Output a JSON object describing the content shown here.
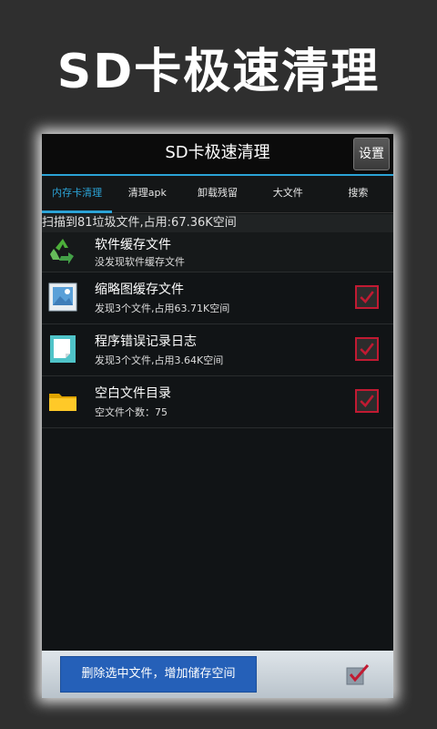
{
  "promo_title": "SD卡极速清理",
  "app": {
    "title": "SD卡极速清理",
    "settings_label": "设置"
  },
  "tabs": [
    {
      "label": "内存卡清理"
    },
    {
      "label": "清理apk"
    },
    {
      "label": "卸载残留"
    },
    {
      "label": "大文件"
    },
    {
      "label": "搜索"
    }
  ],
  "summary": "扫描到81垃圾文件,占用:67.36K空间",
  "items": [
    {
      "name": "软件缓存文件",
      "desc": "没发现软件缓存文件",
      "icon": "recycle-icon",
      "checked": false
    },
    {
      "name": "缩略图缓存文件",
      "desc": "发现3个文件,占用63.71K空间",
      "icon": "image-icon",
      "checked": true
    },
    {
      "name": "程序错误记录日志",
      "desc": "发现3个文件,占用3.64K空间",
      "icon": "document-icon",
      "checked": true
    },
    {
      "name": "空白文件目录",
      "desc": "空文件个数：75",
      "icon": "folder-icon",
      "checked": true
    }
  ],
  "footer": {
    "delete_label": "删除选中文件，增加储存空间",
    "select_all_checked": true
  },
  "colors": {
    "accent": "#2ba3d6",
    "check_red": "#c11a32",
    "button_blue": "#2560b8"
  }
}
